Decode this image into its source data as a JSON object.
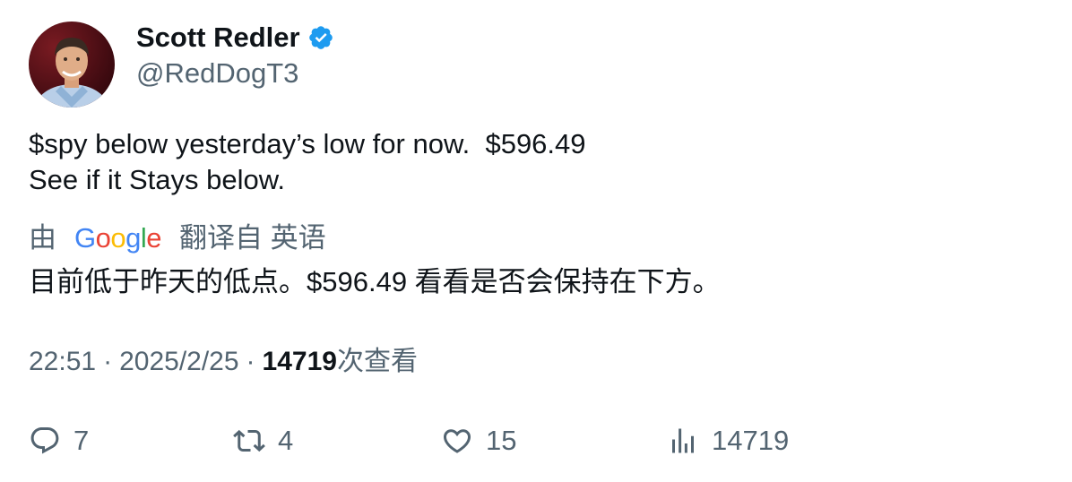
{
  "author": {
    "display_name": "Scott Redler",
    "handle": "@RedDogT3",
    "verified_icon": "verified-badge-icon",
    "brand_color": "#1d9bf0"
  },
  "tweet": {
    "text": "$spy below yesterday’s low for now.  $596.49\nSee if it Stays below."
  },
  "translation": {
    "prefix": "由",
    "google_logo": "Google",
    "suffix": "翻译自 英语",
    "text": "目前低于昨天的低点。$596.49 看看是否会保持在下方。"
  },
  "meta": {
    "time": "22:51",
    "separator": "·",
    "date": "2025/2/25",
    "views_count": "14719",
    "views_label": "次查看"
  },
  "actions": {
    "replies": "7",
    "retweets": "4",
    "likes": "15",
    "views": "14719"
  }
}
